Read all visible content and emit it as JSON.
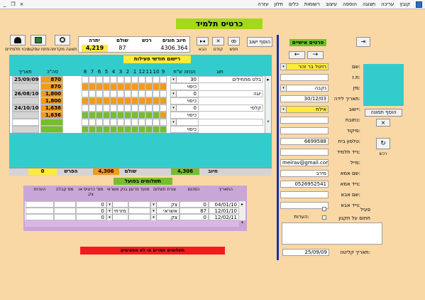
{
  "menu": {
    "items": [
      "קובץ",
      "עריכה",
      "תצוגה",
      "הוספה",
      "עיצוב",
      "רשומות",
      "כלים",
      "חלון",
      "עזרה"
    ],
    "window_controls": [
      "_",
      "❐",
      "×"
    ]
  },
  "title": "כרטיס תלמיד",
  "toolbar": {
    "add_settlement": "הוסף ישוב",
    "nav_captions": [
      "הבא",
      "קודם",
      "חפש",
      "לקוח"
    ],
    "captions_left": [
      "גיבוי תלמידים",
      "פתח עסקות",
      "תצוגה מקדימה"
    ]
  },
  "summary": {
    "headers": {
      "debt": "יתרה",
      "paid": "שולם",
      "credit": "רכש",
      "charges": "חיוב חוגים"
    },
    "values": {
      "debt": "4,219",
      "paid": "87",
      "charges": "4306.364"
    }
  },
  "activity": {
    "title": "רישום חודשי פעילות",
    "headers": {
      "circle": "חוג",
      "discount": "הנחה ש\"ח",
      "months": [
        "9",
        "10",
        "11",
        "12",
        "1",
        "2",
        "3",
        "4",
        "5",
        "6",
        "7",
        "8"
      ],
      "total": "סה\"כ",
      "date": "תאריך"
    },
    "rows": [
      {
        "circle": "בלט מתחילים",
        "discount": "30",
        "total": "870",
        "total2": "870",
        "date": "25/09/09",
        "label2": "כיסוי"
      },
      {
        "circle": "יוגה",
        "discount": "0",
        "total": "1,800",
        "total2": "1,800",
        "date": "26/08/10",
        "label2": "כיסוי"
      },
      {
        "circle": "קלסי",
        "discount": "0",
        "total": "1,636",
        "total2": "1,636",
        "date": "24/10/10",
        "label2": "כיסוי"
      }
    ],
    "new_row_label2": "כיסוי",
    "footer": {
      "charge_label": "חיוב",
      "charge_value": "4,306",
      "paid_label": "שולם",
      "paid_value": "4,306",
      "diff_label": "הפרש",
      "diff_value": "0"
    }
  },
  "payments": {
    "title": "תשלומים בפועל",
    "headers": [
      "התאריך",
      "הסכום",
      "צורת תשלום",
      "מועד פרעון",
      "בנק אשראי",
      "מס' כרטיס או צק",
      "מס קבלה",
      "הערות"
    ],
    "rows": [
      {
        "date": "04/01/10",
        "amount": "0",
        "method": "צק",
        "bank": "",
        "card": "0"
      },
      {
        "date": "12/01/10",
        "amount": "87",
        "method": "אשראי",
        "bank": "מזרחי",
        "card": "0"
      },
      {
        "date": "12/02/11",
        "amount": "0",
        "method": "צק",
        "bank": "",
        "card": "0"
      }
    ],
    "warning": "תשלומים חסרים או לא מתאימים"
  },
  "personal": {
    "header": "פרטים אישיים",
    "fields": [
      {
        "label": "שם:",
        "value": "רויטל בר זהר"
      },
      {
        "label": "ת.ז:",
        "value": ""
      },
      {
        "label": "מין:",
        "value": "נקבה"
      },
      {
        "label": "תאריך לידה:",
        "value": "30/12/03"
      },
      {
        "label": "יישוב:",
        "value": "אילת"
      },
      {
        "label": "כתובת:",
        "value": ""
      },
      {
        "label": "מיקוד:",
        "value": ""
      },
      {
        "label": "טלפון בית:",
        "value": "6699588"
      },
      {
        "label": "נייד תלמיד:",
        "value": ""
      },
      {
        "label": "מייל:",
        "value": "meirav@gmail.com"
      },
      {
        "label": "שם אמא:",
        "value": "מירב"
      },
      {
        "label": "נייד אמא:",
        "value": "0526952541"
      },
      {
        "label": "שם אבא:",
        "value": ""
      },
      {
        "label": "נייד אבא:",
        "value": ""
      }
    ],
    "active_label": "פעיל",
    "agreement_label": "חתום על תקנון",
    "notes_label": "הערות:",
    "registration_label": "תאריך קליטה:",
    "registration_date": "25/09/09",
    "add_photo": "הוסף תמונה",
    "remove_photo": "×",
    "credit_caption": "רכש"
  }
}
